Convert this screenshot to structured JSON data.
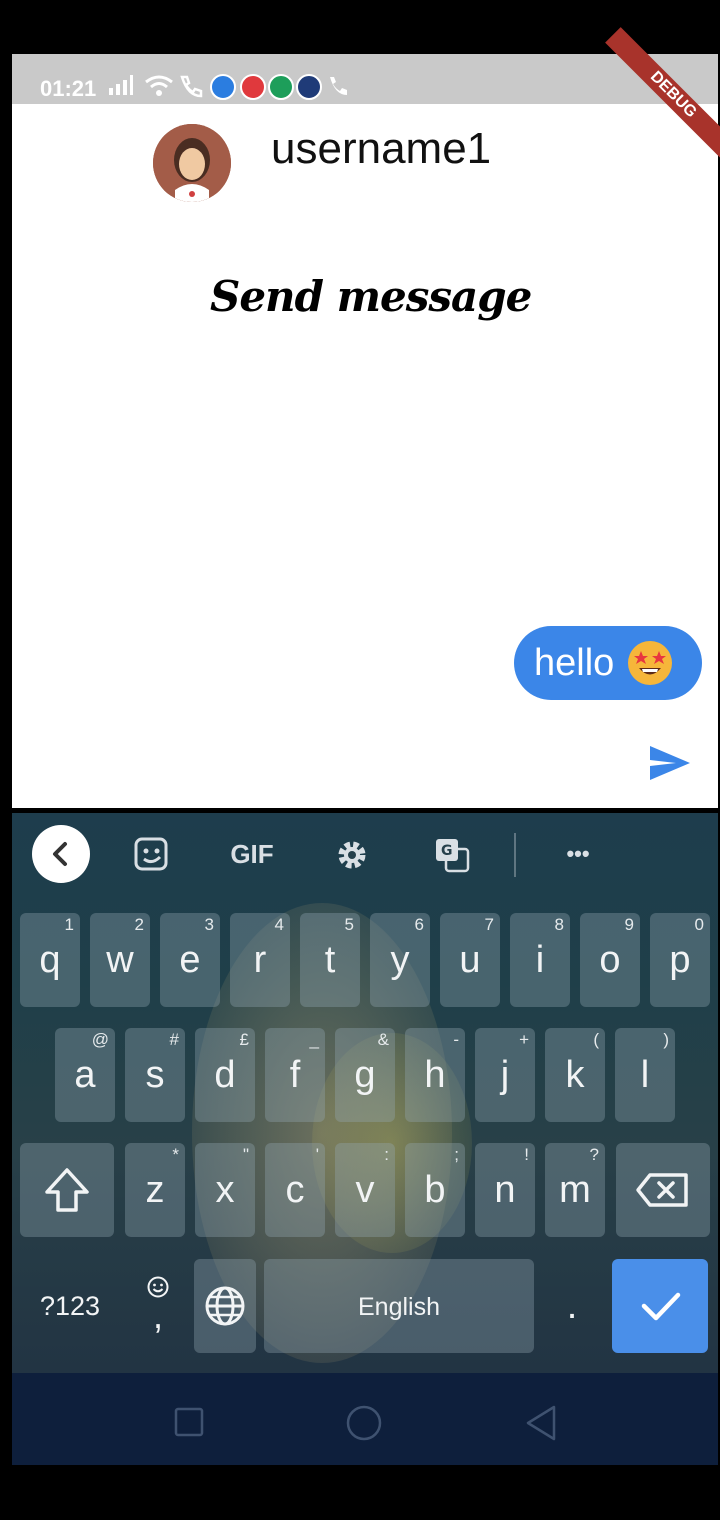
{
  "status_bar": {
    "time": "01:21",
    "icons": [
      "signal-icon",
      "wifi-icon",
      "call-icon",
      "messenger-icon",
      "video-icon",
      "app-icon",
      "app-icon",
      "phone-icon"
    ]
  },
  "debug_ribbon": "DEBUG",
  "chat": {
    "username": "username1",
    "title": "Send message",
    "messages": [
      {
        "text": "hello",
        "emoji": "star-struck-emoji",
        "sent": true
      }
    ],
    "colors": {
      "bubble": "#3b86e8",
      "send_icon": "#3b86e8"
    }
  },
  "keyboard": {
    "toolbar": [
      "back-icon",
      "sticker-icon",
      "GIF",
      "settings-icon",
      "translate-icon",
      "more-icon"
    ],
    "gif_label": "GIF",
    "more_label": "•••",
    "row1": [
      {
        "k": "q",
        "h": "1"
      },
      {
        "k": "w",
        "h": "2"
      },
      {
        "k": "e",
        "h": "3"
      },
      {
        "k": "r",
        "h": "4"
      },
      {
        "k": "t",
        "h": "5"
      },
      {
        "k": "y",
        "h": "6"
      },
      {
        "k": "u",
        "h": "7"
      },
      {
        "k": "i",
        "h": "8"
      },
      {
        "k": "o",
        "h": "9"
      },
      {
        "k": "p",
        "h": "0"
      }
    ],
    "row2": [
      {
        "k": "a",
        "h": "@"
      },
      {
        "k": "s",
        "h": "#"
      },
      {
        "k": "d",
        "h": "£"
      },
      {
        "k": "f",
        "h": "_"
      },
      {
        "k": "g",
        "h": "&"
      },
      {
        "k": "h",
        "h": "-"
      },
      {
        "k": "j",
        "h": "+"
      },
      {
        "k": "k",
        "h": "("
      },
      {
        "k": "l",
        "h": ")"
      }
    ],
    "row3": [
      {
        "k": "z",
        "h": "*"
      },
      {
        "k": "x",
        "h": "\""
      },
      {
        "k": "c",
        "h": "'"
      },
      {
        "k": "v",
        "h": ":"
      },
      {
        "k": "b",
        "h": ";"
      },
      {
        "k": "n",
        "h": "!"
      },
      {
        "k": "m",
        "h": "?"
      }
    ],
    "sym_label": "?123",
    "comma_label": ",",
    "space_label": "English",
    "period_label": ".",
    "accent": "#4a8fe9"
  }
}
